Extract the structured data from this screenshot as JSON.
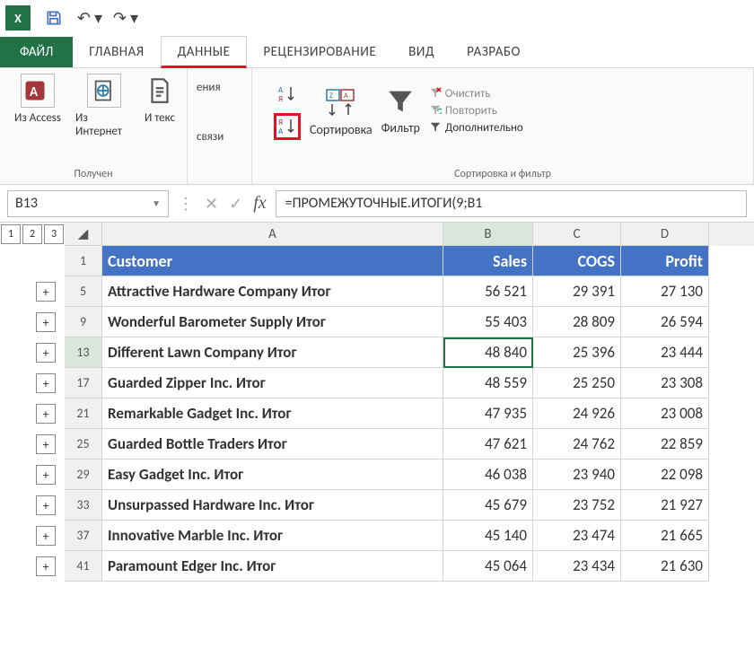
{
  "qat": {
    "app": "X"
  },
  "tabs": {
    "file": "ФАЙЛ",
    "home": "ГЛАВНАЯ",
    "data": "ДАННЫЕ",
    "review": "РЕЦЕНЗИРОВАНИЕ",
    "view": "ВИД",
    "dev": "РАЗРАБО"
  },
  "ribbon": {
    "ext": {
      "access": "Из Access",
      "web": "Из Интернет",
      "text": "И текс",
      "group": "Получен"
    },
    "conn": {
      "a": "ения",
      "b": "связи"
    },
    "sort": {
      "az": "А↓Я",
      "za": "Я↓А",
      "big": "Сортировка",
      "filter": "Фильтр",
      "clear": "Очистить",
      "reapply": "Повторить",
      "advanced": "Дополнительно",
      "group": "Сортировка и фильтр"
    }
  },
  "fbar": {
    "name": "B13",
    "formula": "=ПРОМЕЖУТОЧНЫЕ.ИТОГИ(9;B1"
  },
  "outline": {
    "levels": [
      "1",
      "2",
      "3"
    ]
  },
  "headers": {
    "a": "Customer",
    "b": "Sales",
    "c": "COGS",
    "d": "Profit"
  },
  "rows": [
    {
      "n": "5",
      "a": "Attractive Hardware Company Итог",
      "b": "56 521",
      "c": "29 391",
      "d": "27 130"
    },
    {
      "n": "9",
      "a": "Wonderful Barometer Supply Итог",
      "b": "55 403",
      "c": "28 809",
      "d": "26 594"
    },
    {
      "n": "13",
      "a": "Different Lawn Company Итог",
      "b": "48 840",
      "c": "25 396",
      "d": "23 444",
      "sel": true
    },
    {
      "n": "17",
      "a": "Guarded Zipper Inc. Итог",
      "b": "48 559",
      "c": "25 250",
      "d": "23 308"
    },
    {
      "n": "21",
      "a": "Remarkable Gadget Inc. Итог",
      "b": "47 935",
      "c": "24 926",
      "d": "23 008"
    },
    {
      "n": "25",
      "a": "Guarded Bottle Traders Итог",
      "b": "47 621",
      "c": "24 762",
      "d": "22 859"
    },
    {
      "n": "29",
      "a": "Easy Gadget Inc. Итог",
      "b": "46 038",
      "c": "23 940",
      "d": "22 098"
    },
    {
      "n": "33",
      "a": "Unsurpassed Hardware Inc. Итог",
      "b": "45 679",
      "c": "23 752",
      "d": "21 927"
    },
    {
      "n": "37",
      "a": "Innovative Marble Inc. Итог",
      "b": "45 140",
      "c": "23 474",
      "d": "21 665"
    },
    {
      "n": "41",
      "a": "Paramount Edger Inc. Итог",
      "b": "45 064",
      "c": "23 434",
      "d": "21 630"
    }
  ]
}
